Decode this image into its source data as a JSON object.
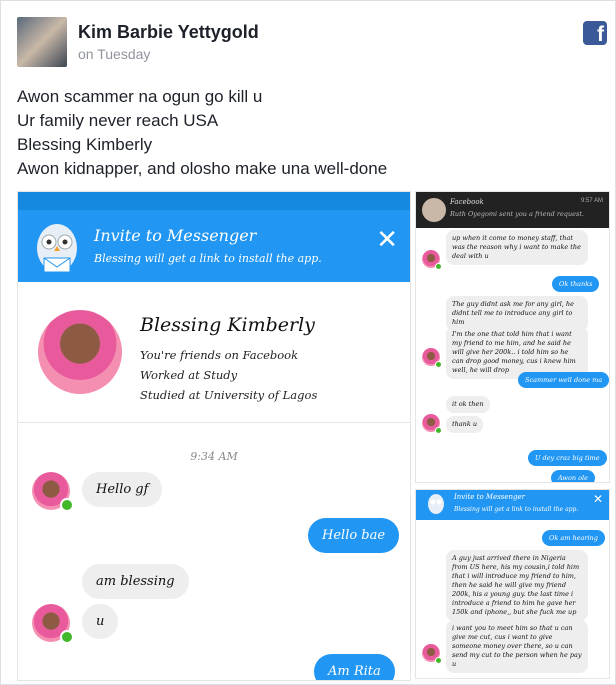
{
  "post": {
    "author": "Kim Barbie Yettygold",
    "time": "on Tuesday",
    "lines": [
      "Awon scammer na ogun go kill u",
      "Ur family never reach USA",
      "Blessing Kimberly",
      "Awon kidnapper, and olosho make una well-done"
    ],
    "platform_icon": "facebook-icon"
  },
  "shot1": {
    "invite_title": "Invite to Messenger",
    "invite_sub": "Blessing will get a link to install the app.",
    "close_glyph": "✕",
    "profile_name": "Blessing Kimberly",
    "profile_lines": [
      "You're friends on Facebook",
      "Worked at Study",
      "Studied at University of Lagos"
    ],
    "time": "9:34 AM",
    "messages": [
      {
        "dir": "in",
        "text": "Hello gf"
      },
      {
        "dir": "out",
        "text": "Hello bae"
      },
      {
        "dir": "in",
        "text": "am blessing"
      },
      {
        "dir": "in",
        "text": "u"
      },
      {
        "dir": "out",
        "text": "Am Rita"
      }
    ]
  },
  "shot2": {
    "notif_title": "Facebook",
    "notif_sub": "Ruth Oyegomi sent you a friend request.",
    "notif_time": "9:57 AM",
    "messages": [
      {
        "dir": "in",
        "text": "up when it come to money staff, that was the reason why i want to make the deal with u"
      },
      {
        "dir": "out",
        "text": "Ok thanks"
      },
      {
        "dir": "in",
        "text": "The guy didnt ask me for any girl, he didnt tell me to introduce any girl to him"
      },
      {
        "dir": "in",
        "text": "I'm the one that told him that i want my friend to me him, and he said he will give her 200k.. i told him so he can drop good money, cus i knew him well, he will drop"
      },
      {
        "dir": "out",
        "text": "Scammer well done ma"
      },
      {
        "dir": "in",
        "text": "it ok then"
      },
      {
        "dir": "in",
        "text": "thank u"
      },
      {
        "dir": "out",
        "text": "U dey craz big time"
      },
      {
        "dir": "out",
        "text": "Awon ole"
      }
    ]
  },
  "shot3": {
    "invite_title": "Invite to Messenger",
    "invite_sub": "Blessing will get a link to install the app.",
    "close_glyph": "✕",
    "messages": [
      {
        "dir": "out",
        "text": "Ok am hearing"
      },
      {
        "dir": "in",
        "text": "A guy just arrived there in Nigeria from US here, his my cousin,i told him that i will introduce my friend to him, then he said he will give my friend 200k, his a young guy. the last time i introduce a friend to him he gave her 150k and iphone,, but she fuck me up"
      },
      {
        "dir": "in",
        "text": "i want you to meet him so that u can give me cut, cus i want to give someone money over there, so u can send my cut to the person when he pay u"
      }
    ]
  }
}
